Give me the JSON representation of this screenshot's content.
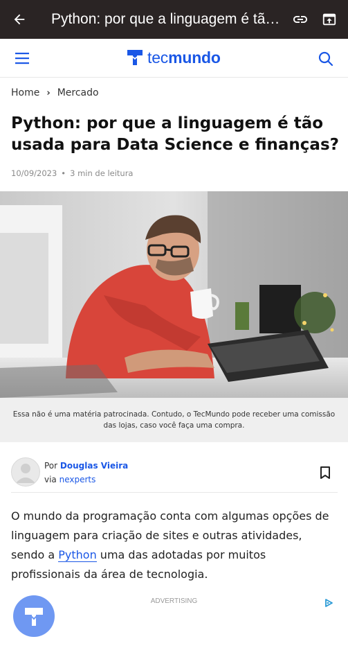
{
  "topbar": {
    "title": "Python: por que a linguagem é tão usada para Data Science e finanças?"
  },
  "header": {
    "brand_prefix": "tec",
    "brand_bold": "mundo"
  },
  "breadcrumb": {
    "home": "Home",
    "section": "Mercado"
  },
  "article": {
    "title": "Python: por que a linguagem é tão usada para Data Science e finanças?",
    "date": "10/09/2023",
    "read_time": "3 min de leitura",
    "disclaimer": "Essa não é uma matéria patrocinada. Contudo, o TecMundo pode receber uma comissão das lojas, caso você faça uma compra.",
    "author_prefix": "Por ",
    "author": "Douglas Vieira",
    "via_prefix": "via ",
    "via": "nexperts",
    "body_before": "O mundo da programação conta com algumas opções de linguagem para criação de sites e outras atividades, sendo a ",
    "body_link": "Python",
    "body_after": " uma das adotadas por muitos profissionais da área de tecnologia."
  },
  "ad": {
    "label": "ADVERTISING"
  },
  "colors": {
    "brand": "#1a57e6",
    "topbar": "#2a2424",
    "fab": "#6f98f2"
  },
  "icons": [
    "back-arrow-icon",
    "link-icon",
    "open-in-app-icon",
    "hamburger-menu-icon",
    "tecmundo-logo-icon",
    "search-icon",
    "chevron-right-icon",
    "bookmark-icon",
    "adchoices-icon",
    "tecmundo-fab-icon"
  ]
}
